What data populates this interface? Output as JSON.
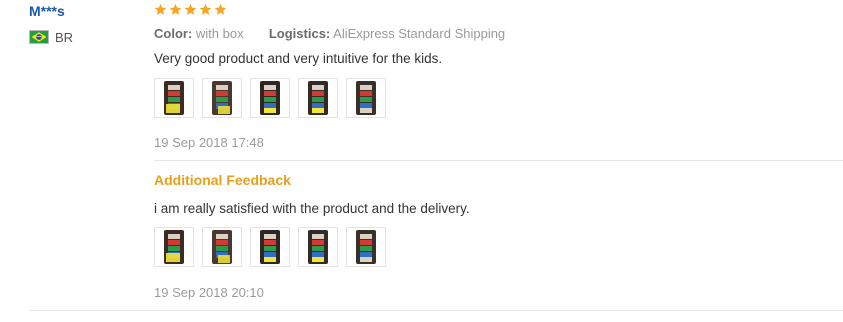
{
  "user": {
    "name": "M***s",
    "country_code": "BR",
    "flag_icon": "brazil-flag-icon"
  },
  "review": {
    "rating": 5,
    "rating_max": 5,
    "star_color": "#f5a623",
    "color_label": "Color:",
    "color_value": "with box",
    "logistics_label": "Logistics:",
    "logistics_value": "AliExpress Standard Shipping",
    "text": "Very good product and very intuitive for the kids.",
    "photo_count": 5,
    "date": "19 Sep 2018 17:48"
  },
  "additional_feedback": {
    "title": "Additional Feedback",
    "text": "i am really satisfied with the product and the delivery.",
    "photo_count": 5,
    "date": "19 Sep 2018 20:10",
    "title_color": "#e6a01b"
  }
}
